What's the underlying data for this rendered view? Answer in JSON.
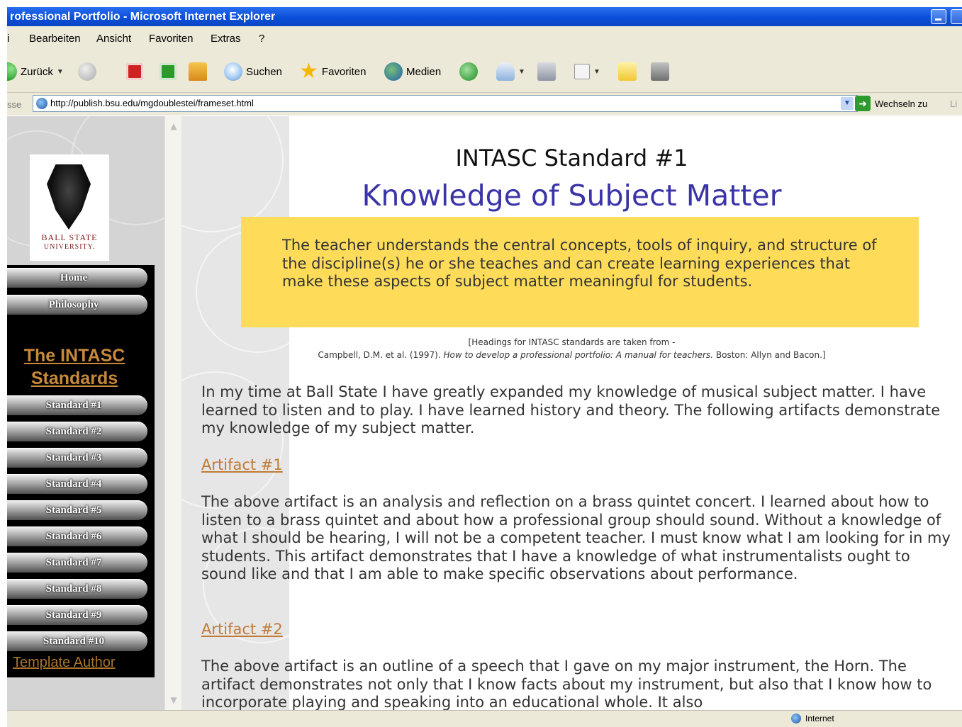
{
  "window": {
    "title": "rofessional Portfolio - Microsoft Internet Explorer"
  },
  "menubar": {
    "items": [
      "i",
      "Bearbeiten",
      "Ansicht",
      "Favoriten",
      "Extras",
      "?"
    ]
  },
  "toolbar": {
    "back_label": "Zurück",
    "search_label": "Suchen",
    "favorites_label": "Favoriten",
    "media_label": "Medien"
  },
  "addressbar": {
    "label": "sse",
    "url": "http://publish.bsu.edu/mgdoublestei/frameset.html",
    "go_label": "Wechseln zu",
    "links_label": "Li"
  },
  "nav": {
    "logo_line1": "BALL STATE",
    "logo_line2": "UNIVERSITY.",
    "home_label": "Home",
    "philosophy_label": "Philosophy",
    "section_heading": "The INTASC Standards",
    "standards": [
      "Standard #1",
      "Standard #2",
      "Standard #3",
      "Standard #4",
      "Standard #5",
      "Standard #6",
      "Standard #7",
      "Standard #8",
      "Standard #9",
      "Standard #10"
    ],
    "footer_link": "Template Author"
  },
  "content": {
    "standard_label": "INTASC Standard #1",
    "standard_name": "Knowledge of Subject Matter",
    "definition": "The teacher understands the central concepts, tools of inquiry, and structure of the discipline(s) he or she teaches and can create learning experiences that make these aspects of subject matter meaningful for students.",
    "citation_line1": "[Headings for INTASC standards are taken from -",
    "citation_author": "Campbell, D.M. et al. (1997).",
    "citation_title": "How to develop a professional portfolio: A manual for teachers.",
    "citation_publisher": "Boston: Allyn and Bacon.]",
    "intro": "In my time at Ball State I have greatly expanded my knowledge of musical subject matter.  I have learned to listen and to play.  I have learned history and theory.  The following artifacts demonstrate my knowledge of my subject matter.",
    "artifact1_label": "Artifact #1",
    "artifact1_text": "The above artifact is an analysis and reflection on a brass quintet concert.  I learned about how to listen to a brass quintet and about how a professional group should sound.  Without a knowledge of what I should be hearing, I will not be a competent teacher.  I must know what I am looking for in my students.  This artifact demonstrates that I have a knowledge of what instrumentalists ought to sound like and that I am able to make specific observations about performance.",
    "artifact2_label": "Artifact #2",
    "artifact2_text": "The above artifact is an outline of a speech that I gave on my major instrument, the Horn.  The artifact demonstrates not only that I know facts about my instrument, but also that I know how to incorporate playing and speaking into an educational whole.  It also"
  },
  "statusbar": {
    "zone": "Internet"
  },
  "colors": {
    "title_blue": "#0a4fd8",
    "heading_purple": "#3a34a8",
    "definition_yellow": "#fedc5a",
    "link_brown": "#c07a35"
  }
}
